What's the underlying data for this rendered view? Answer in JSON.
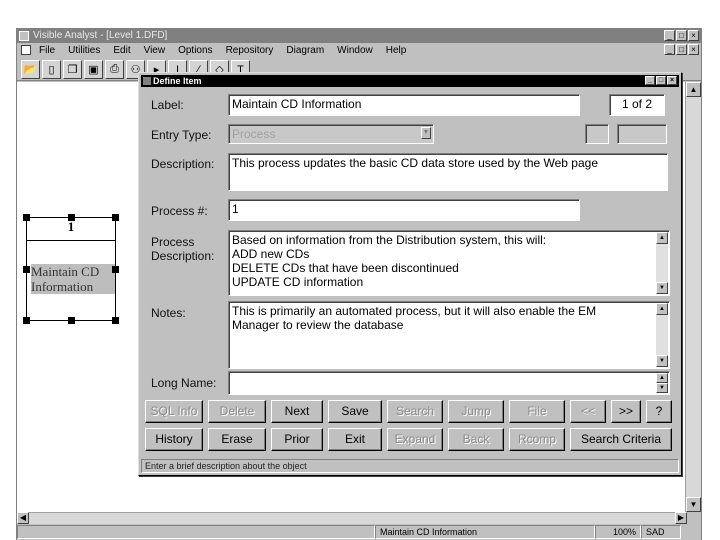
{
  "app": {
    "title": "Visible Analyst - [Level 1.DFD]",
    "window_buttons": [
      "_",
      "□",
      "×"
    ],
    "mdi_buttons": [
      "_",
      "□",
      "×"
    ]
  },
  "menu": [
    "File",
    "Utilities",
    "Edit",
    "View",
    "Options",
    "Repository",
    "Diagram",
    "Window",
    "Help"
  ],
  "toolbar_icons": [
    "open-folder-icon",
    "new-page-icon",
    "copy-icon",
    "save-disk-icon",
    "print-icon",
    "binoculars-icon",
    "pointer-icon",
    "text-cursor-icon",
    "line-tool-icon",
    "shape-tool-icon",
    "text-tool-icon"
  ],
  "diagram": {
    "process": {
      "number": "1",
      "name": "Maintain CD Information"
    }
  },
  "dialog": {
    "title": "Define Item",
    "label_caption": "Label:",
    "label_value": "Maintain CD Information",
    "page_indicator": "1 of 2",
    "entry_type_caption": "Entry Type:",
    "entry_type_value": "Process",
    "description_caption": "Description:",
    "description_value": "This process updates the basic CD data store used by the Web page",
    "process_num_caption": "Process #:",
    "process_num_value": "1",
    "process_desc_caption_1": "Process",
    "process_desc_caption_2": "Description:",
    "process_desc_lines": [
      "Based on information from the Distribution system, this will:",
      "ADD new CDs",
      "DELETE CDs that have been discontinued",
      "UPDATE CD information"
    ],
    "notes_caption": "Notes:",
    "notes_lines": [
      "This is primarily an automated process, but it will also enable the EM",
      "Manager to review the database"
    ],
    "long_name_caption": "Long Name:",
    "long_name_value": "",
    "buttons_row1": [
      {
        "label": "SQL Info",
        "enabled": false
      },
      {
        "label": "Delete",
        "enabled": false
      },
      {
        "label": "Next",
        "enabled": true
      },
      {
        "label": "Save",
        "enabled": true
      },
      {
        "label": "Search",
        "enabled": false
      },
      {
        "label": "Jump",
        "enabled": false
      },
      {
        "label": "File",
        "enabled": false
      },
      {
        "label": "<<",
        "enabled": false
      },
      {
        "label": ">>",
        "enabled": true
      },
      {
        "label": "?",
        "enabled": true
      }
    ],
    "buttons_row2": [
      {
        "label": "History",
        "enabled": true
      },
      {
        "label": "Erase",
        "enabled": true
      },
      {
        "label": "Prior",
        "enabled": true
      },
      {
        "label": "Exit",
        "enabled": true
      },
      {
        "label": "Expand",
        "enabled": false
      },
      {
        "label": "Back",
        "enabled": false
      },
      {
        "label": "Rcomp",
        "enabled": false
      },
      {
        "label": "Search Criteria",
        "enabled": true
      }
    ],
    "status_text": "Enter a brief description about the object"
  },
  "statusbar": {
    "object": "Maintain CD Information",
    "zoom": "100%",
    "mode": "SAD"
  }
}
